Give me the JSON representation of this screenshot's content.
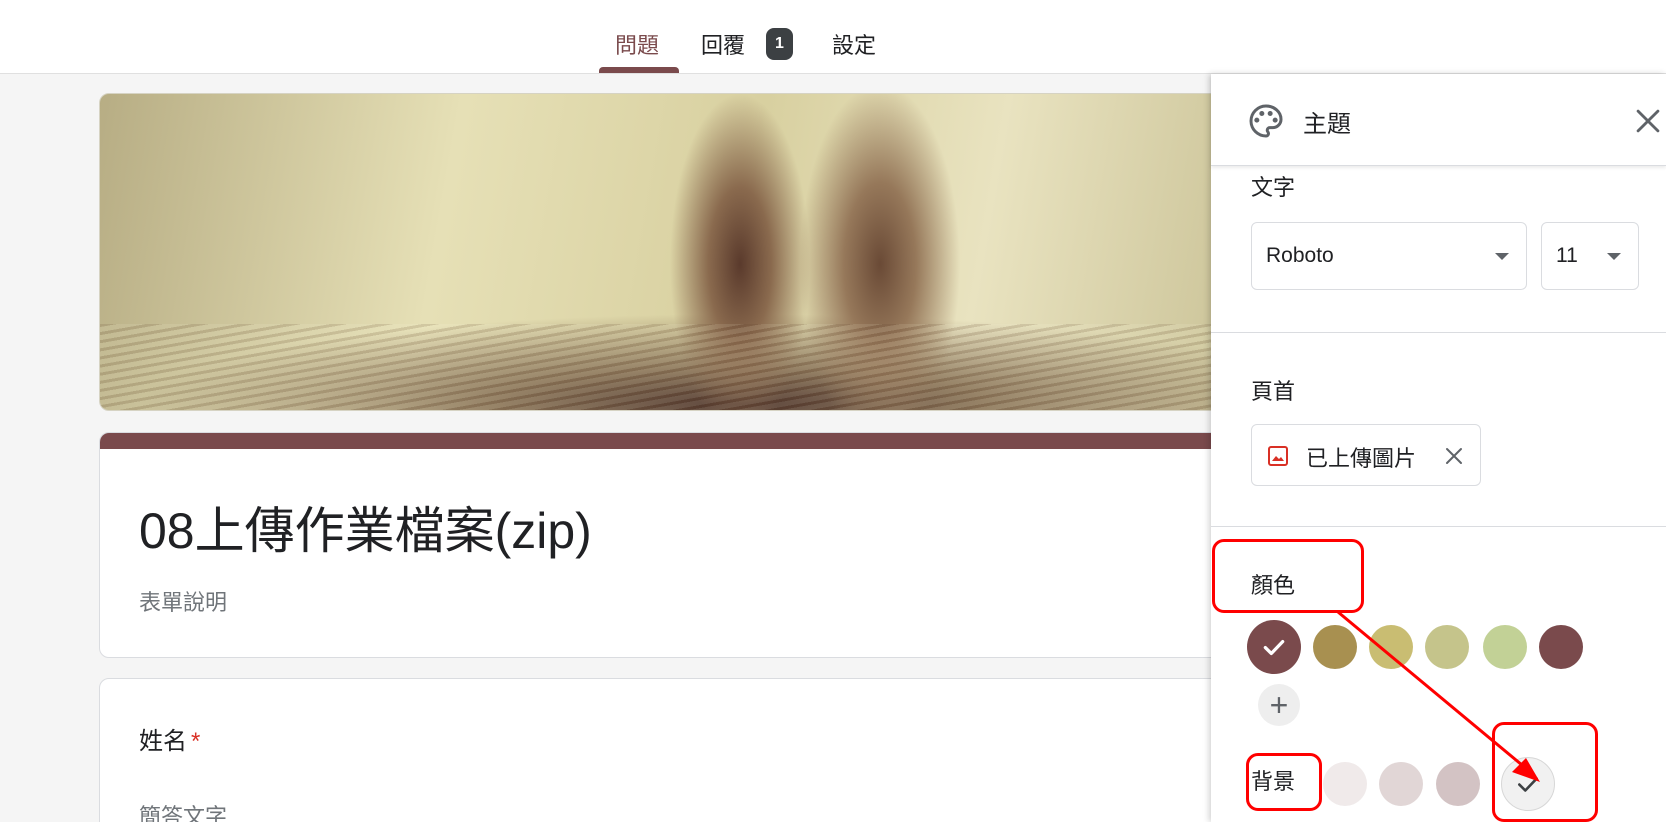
{
  "tabs": [
    {
      "label": "問題"
    },
    {
      "label": "回覆"
    },
    {
      "label": "設定"
    }
  ],
  "responses_badge": "1",
  "form": {
    "title": "08上傳作業檔案(zip)",
    "description": "表單說明"
  },
  "question": {
    "label": "姓名",
    "required_mark": "*",
    "placeholder": "簡答文字"
  },
  "theme_panel": {
    "title": "主題",
    "text_section": {
      "label": "文字",
      "font": "Roboto",
      "size": "11"
    },
    "header_section": {
      "label": "頁首",
      "chip_label": "已上傳圖片"
    },
    "color_section": {
      "label": "顏色",
      "swatches": [
        "#7a4a4c",
        "#a89050",
        "#c9bd72",
        "#c5c48b",
        "#c2d196",
        "#7a4a4c"
      ],
      "selected_index": 0,
      "add_label": "+"
    },
    "background_section": {
      "label": "背景",
      "swatches": [
        "#f0eaea",
        "#e1d6d6",
        "#d3c3c4",
        "#f1f1f1"
      ],
      "selected_index": 3
    }
  },
  "colors": {
    "accent": "#7a4a4c",
    "annotation": "#ff0000"
  }
}
